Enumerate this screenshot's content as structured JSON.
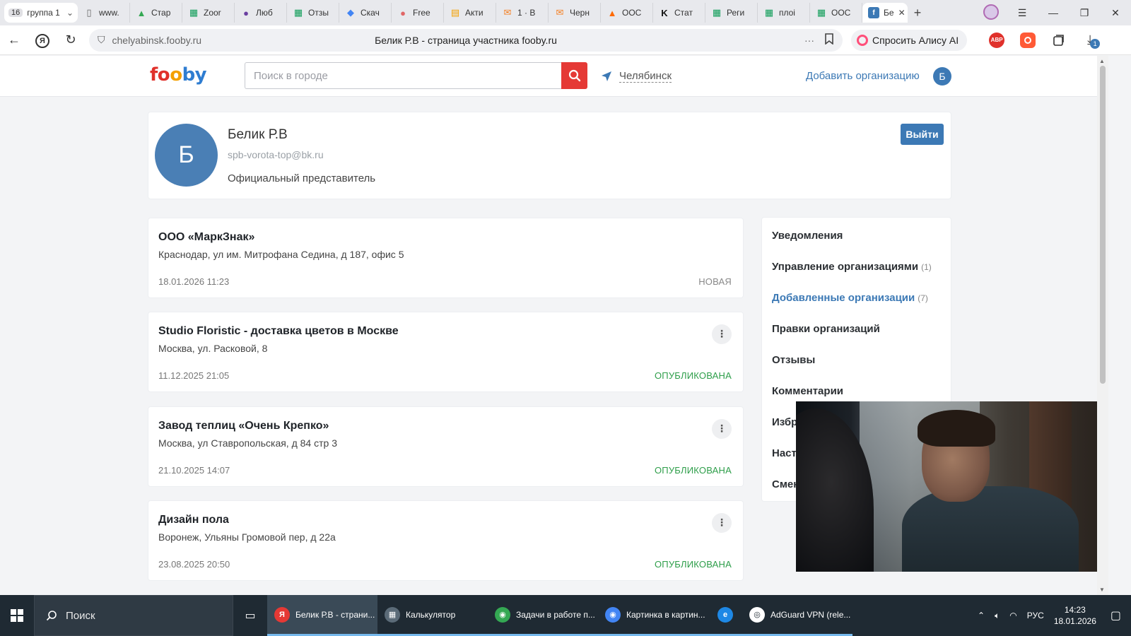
{
  "browser": {
    "tab_group": {
      "count": "16",
      "label": "группа 1"
    },
    "tabs": [
      {
        "label": "www.",
        "icon": "page-icon",
        "color": "#666666"
      },
      {
        "label": "Стар",
        "icon": "google-drive-icon",
        "color": "#34a853"
      },
      {
        "label": "Zoor",
        "icon": "google-sheets-icon",
        "color": "#0f9d58"
      },
      {
        "label": "Люб",
        "icon": "circle-icon",
        "color": "#6a3fa0"
      },
      {
        "label": "Отзы",
        "icon": "google-sheets-icon",
        "color": "#0f9d58"
      },
      {
        "label": "Скач",
        "icon": "gemini-icon",
        "color": "#4285f4"
      },
      {
        "label": "Free",
        "icon": "circle-icon",
        "color": "#e06666"
      },
      {
        "label": "Акти",
        "icon": "chat-icon",
        "color": "#f4a000"
      },
      {
        "label": "1 · В",
        "icon": "mail-icon",
        "color": "#f48024"
      },
      {
        "label": "Черн",
        "icon": "mail-icon",
        "color": "#f48024"
      },
      {
        "label": "ООС",
        "icon": "flame-icon",
        "color": "#ff6a00"
      },
      {
        "label": "Стат",
        "icon": "k-icon",
        "color": "#111111"
      },
      {
        "label": "Реги",
        "icon": "google-sheets-icon",
        "color": "#0f9d58"
      },
      {
        "label": "плоі",
        "icon": "google-sheets-icon",
        "color": "#0f9d58"
      },
      {
        "label": "ООС",
        "icon": "google-sheets-icon",
        "color": "#0f9d58"
      }
    ],
    "active_tab": {
      "label": "Бе",
      "icon": "fooby-icon",
      "color": "#3c79b5"
    },
    "url": "chelyabinsk.fooby.ru",
    "page_title": "Белик Р.В - страница участника fooby.ru",
    "alice_button": "Спросить Алису AI",
    "ext_abp": "ABP",
    "downloads_badge": "1"
  },
  "site": {
    "logo": {
      "part1": "fo",
      "part2": "o",
      "part3": "by"
    },
    "search_placeholder": "Поиск в городе",
    "city": "Челябинск",
    "add_org": "Добавить организацию",
    "header_avatar": "Б"
  },
  "profile": {
    "initial": "Б",
    "name": "Белик Р.В",
    "email": "spb-vorota-top@bk.ru",
    "role": "Официальный представитель",
    "logout": "Выйти"
  },
  "orgs": [
    {
      "name": "ООО «МаркЗнак»",
      "address": "Краснодар, ул им. Митрофана Седина, д 187, офис 5",
      "date": "18.01.2026 11:23",
      "status": "НОВАЯ"
    },
    {
      "name": "Studio Floristic - доставка цветов в Москве",
      "address": "Москва, ул. Расковой, 8",
      "date": "11.12.2025 21:05",
      "status": "ОПУБЛИКОВАНА"
    },
    {
      "name": "Завод теплиц «Очень Крепко»",
      "address": "Москва, ул Ставропольская, д 84 стр 3",
      "date": "21.10.2025 14:07",
      "status": "ОПУБЛИКОВАНА"
    },
    {
      "name": "Дизайн пола",
      "address": "Воронеж, Ульяны Громовой пер, д 22а",
      "date": "23.08.2025 20:50",
      "status": "ОПУБЛИКОВАНА"
    }
  ],
  "side_menu": [
    {
      "label": "Уведомления",
      "count": ""
    },
    {
      "label": "Управление организациями",
      "count": "(1)"
    },
    {
      "label": "Добавленные организации",
      "count": "(7)"
    },
    {
      "label": "Правки организаций",
      "count": ""
    },
    {
      "label": "Отзывы",
      "count": ""
    },
    {
      "label": "Комментарии",
      "count": ""
    },
    {
      "label": "Избр",
      "count": ""
    },
    {
      "label": "Настр",
      "count": ""
    },
    {
      "label": "Смен",
      "count": ""
    }
  ],
  "taskbar": {
    "search": "Поиск",
    "apps": [
      {
        "label": "Белик Р.В - страни...",
        "icon": "yandex-browser-icon",
        "color": "#e53935"
      },
      {
        "label": "Калькулятор",
        "icon": "calculator-icon",
        "color": "#5b6b78"
      },
      {
        "label": "Задачи в работе п...",
        "icon": "chrome-icon",
        "color": "#34a853"
      },
      {
        "label": "Картинка в картин...",
        "icon": "chrome-icon",
        "color": "#4285f4"
      },
      {
        "label": "",
        "icon": "edge-icon",
        "color": "#1e88e5"
      },
      {
        "label": "AdGuard VPN (rele...",
        "icon": "adguard-vpn-icon",
        "color": "#ffffff"
      }
    ],
    "lang": "РУС",
    "time": "14:23",
    "date": "18.01.2026"
  }
}
